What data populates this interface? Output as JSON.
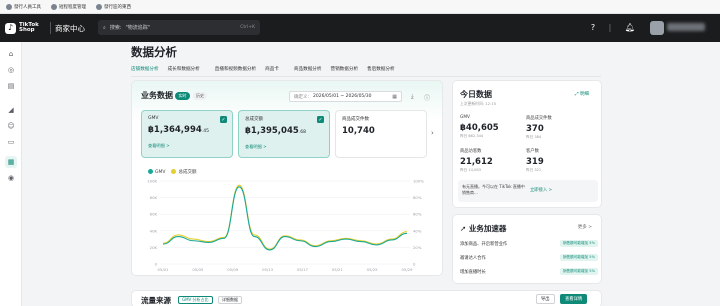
{
  "bookmarks": [
    "發行人員工具",
    "短程程度管理",
    "發行區的東西"
  ],
  "header": {
    "logo_line1": "TikTok",
    "logo_line2": "Shop",
    "brand": "商家中心",
    "search_prefix": "搜索:",
    "search_placeholder": "\"物流追踪\"",
    "search_shortcut": "Ctrl+K"
  },
  "page": {
    "title": "数据分析",
    "tabs": [
      "店铺数据分析",
      "成长和数据分析",
      "直播和视频数据分析",
      "商品卡",
      "商品数据分析",
      "营销数据分析",
      "售后数据分析"
    ]
  },
  "business": {
    "title": "业务数据",
    "pill_active": "实时",
    "pill_other": "历史",
    "date_label": "确定义:",
    "date_range": "2026/05/01 ~ 2026/05/30",
    "metrics": [
      {
        "label": "GMV",
        "currency": "฿",
        "value": "1,364,994",
        "decimal": ".45",
        "link": "查看明细 >"
      },
      {
        "label": "总成交额",
        "currency": "฿",
        "value": "1,395,045",
        "decimal": ".68",
        "link": "查看明细 >"
      },
      {
        "label": "商品成交件数",
        "currency": "",
        "value": "10,740",
        "decimal": "",
        "link": ""
      }
    ],
    "legend": [
      "GMV",
      "总成交额"
    ]
  },
  "chart_data": {
    "type": "line",
    "y_left_ticks": [
      "0",
      "20K",
      "40K",
      "60K",
      "80K",
      "100K"
    ],
    "y_right_ticks": [
      "0",
      "20%",
      "40%",
      "60%",
      "80%",
      "100%"
    ],
    "x": [
      "05/01",
      "05/05",
      "05/09",
      "05/13",
      "05/17",
      "05/21",
      "05/25",
      "05/29"
    ],
    "ylim": [
      0,
      100000
    ],
    "series": [
      {
        "name": "GMV",
        "color": "#1aa896",
        "values": [
          24000,
          33000,
          28000,
          26000,
          31000,
          93000,
          33000,
          17000,
          33000,
          28000,
          21000,
          27000,
          30000,
          27000,
          23000,
          29000,
          37000
        ]
      },
      {
        "name": "总成交额",
        "color": "#e4cf2f",
        "values": [
          25000,
          35000,
          30000,
          27000,
          32000,
          95000,
          35000,
          18000,
          34000,
          29000,
          22000,
          28000,
          31000,
          28000,
          24000,
          30000,
          39000
        ]
      }
    ]
  },
  "today": {
    "title": "今日数据",
    "updated": "上次更新时间: 12:15",
    "detail_link": "明细",
    "metrics": [
      {
        "label": "GMV",
        "value": "฿40,605",
        "yesterday": "昨日 ฿62,344"
      },
      {
        "label": "商品成交件数",
        "value": "370",
        "yesterday": "昨日 384"
      },
      {
        "label": "商品访客数",
        "value": "21,612",
        "yesterday": "昨日 14,083"
      },
      {
        "label": "客户数",
        "value": "319",
        "yesterday": "昨日 321"
      }
    ],
    "promo_text": "有无直播。今可以在 TikTok 直播中销售商...",
    "promo_link": "立即接入 >"
  },
  "accelerator": {
    "title": "业务加速器",
    "more": "更多 >",
    "items": [
      {
        "label": "添加商品、开启新营业作",
        "badge": "销售额可能增加 5%"
      },
      {
        "label": "邀请达人合作",
        "badge": "销售额可能增加 5%"
      },
      {
        "label": "增加直播时长",
        "badge": "销售额可能增加 5%"
      }
    ]
  },
  "bottom": {
    "title": "流量来源",
    "tag1": "GMV 分析占比",
    "tag2": "详细数据",
    "btn1": "导出",
    "btn2": "查看详情"
  }
}
